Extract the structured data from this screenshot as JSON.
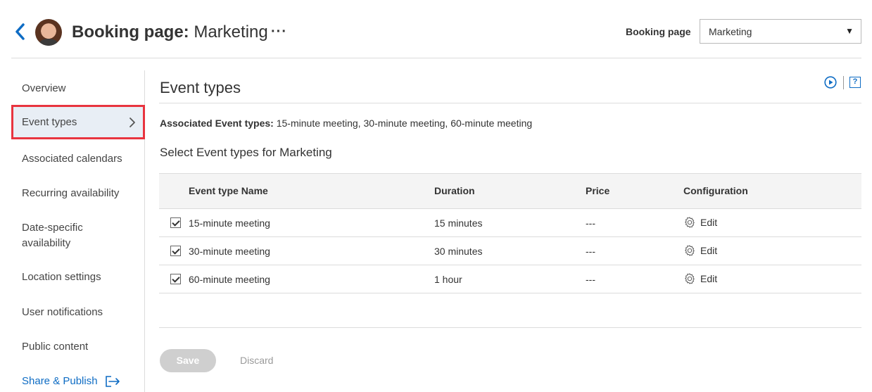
{
  "header": {
    "title_bold": "Booking page:",
    "title_name": "Marketing",
    "more_label": "···",
    "booking_page_label": "Booking page",
    "booking_page_value": "Marketing",
    "select_arrow": "▼"
  },
  "sidebar": {
    "items": [
      {
        "label": "Overview"
      },
      {
        "label": "Event types"
      },
      {
        "label": "Associated calendars"
      },
      {
        "label": "Recurring availability"
      },
      {
        "label": "Date-specific availability"
      },
      {
        "label": "Location settings"
      },
      {
        "label": "User notifications"
      },
      {
        "label": "Public content"
      },
      {
        "label": "Share & Publish"
      }
    ],
    "active_index": 1
  },
  "main": {
    "section_title": "Event types",
    "help_label": "?",
    "associated_label": "Associated Event types:",
    "associated_value": "15-minute meeting, 30-minute meeting, 60-minute meeting",
    "select_title": "Select Event types for Marketing",
    "table": {
      "headers": [
        "Event type Name",
        "Duration",
        "Price",
        "Configuration"
      ],
      "rows": [
        {
          "name": "15-minute meeting",
          "duration": "15 minutes",
          "price": "---",
          "config": "Edit",
          "checked": true
        },
        {
          "name": "30-minute meeting",
          "duration": "30 minutes",
          "price": "---",
          "config": "Edit",
          "checked": true
        },
        {
          "name": "60-minute meeting",
          "duration": "1 hour",
          "price": "---",
          "config": "Edit",
          "checked": true
        }
      ]
    },
    "save_label": "Save",
    "discard_label": "Discard"
  },
  "colors": {
    "accent": "#0e6cc4",
    "active_highlight_border": "#e8343f",
    "active_bg": "#e8eef5"
  }
}
